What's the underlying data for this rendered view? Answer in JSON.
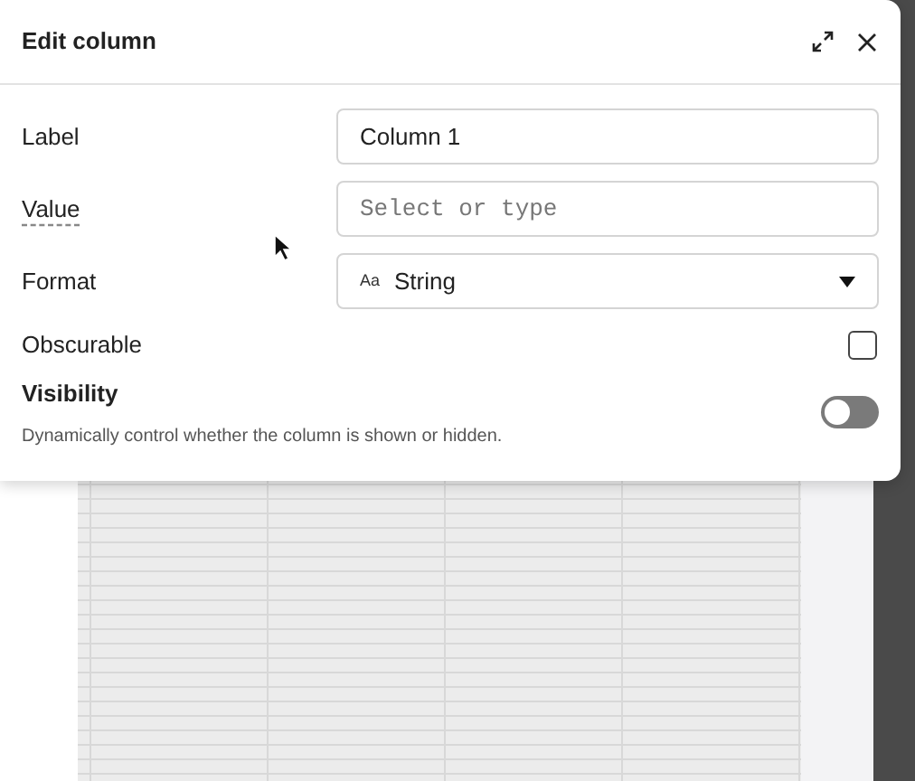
{
  "dialog": {
    "title": "Edit column",
    "fields": [
      {
        "kind": "text",
        "label": "Label",
        "value": "Column 1"
      },
      {
        "kind": "combo",
        "label": "Value",
        "placeholder": "Select or type"
      },
      {
        "kind": "select",
        "label": "Format",
        "type_glyph": "Aa",
        "value": "String"
      },
      {
        "kind": "checkbox",
        "label": "Obscurable",
        "checked": false
      }
    ],
    "visibility": {
      "title": "Visibility",
      "description": "Dynamically control whether the column is shown or hidden.",
      "on": false
    }
  }
}
